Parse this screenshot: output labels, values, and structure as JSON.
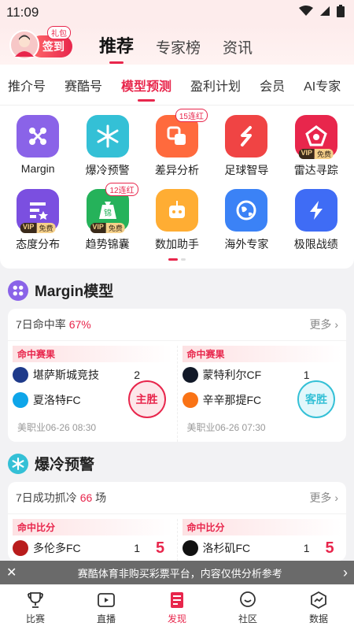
{
  "status_bar": {
    "time": "11:09"
  },
  "header": {
    "signin_label": "签到",
    "gift_tag": "礼包",
    "tabs": [
      {
        "label": "推荐"
      },
      {
        "label": "专家榜"
      },
      {
        "label": "资讯"
      }
    ]
  },
  "sub_tabs": [
    {
      "label": "推介号"
    },
    {
      "label": "赛酷号"
    },
    {
      "label": "模型预测"
    },
    {
      "label": "盈利计划"
    },
    {
      "label": "会员"
    },
    {
      "label": "AI专家"
    }
  ],
  "grid": {
    "row1": [
      {
        "label": "Margin",
        "icon": "margin-icon",
        "color": "#8a63e8"
      },
      {
        "label": "爆冷预警",
        "icon": "snowflake-icon",
        "color": "#34c0d6"
      },
      {
        "label": "差异分析",
        "icon": "difference-icon",
        "color": "#ff6a3d",
        "badge": "15连红"
      },
      {
        "label": "足球智导",
        "icon": "soccer-guide-icon",
        "color": "#f04444"
      },
      {
        "label": "雷达寻踪",
        "icon": "radar-icon",
        "color": "#e8264c",
        "vip": true
      }
    ],
    "row2": [
      {
        "label": "态度分布",
        "icon": "attitude-icon",
        "color": "#7b4fe0",
        "vip": true
      },
      {
        "label": "趋势锦囊",
        "icon": "trend-icon",
        "color": "#25b25a",
        "badge": "12连红",
        "vip": true
      },
      {
        "label": "数加助手",
        "icon": "robot-icon",
        "color": "#ffad33"
      },
      {
        "label": "海外专家",
        "icon": "globe-icon",
        "color": "#3b82f6"
      },
      {
        "label": "极限战绩",
        "icon": "lightning-icon",
        "color": "#3f6cf5"
      }
    ],
    "vip_text": "VIP",
    "free_text": "免费"
  },
  "margin_section": {
    "title": "Margin模型",
    "rate_label": "7日命中率",
    "rate_value": "67%",
    "more": "更多",
    "matches": [
      {
        "tag": "命中赛果",
        "home": "堪萨斯城竞技",
        "home_score": "2",
        "away": "夏洛特FC",
        "away_score": "1",
        "stamp": "主胜",
        "meta": "美职业06-26 08:30"
      },
      {
        "tag": "命中赛果",
        "home": "蒙特利尔CF",
        "home_score": "1",
        "away": "辛辛那提FC",
        "away_score": "3",
        "stamp": "客胜",
        "meta": "美职业06-26 07:30"
      }
    ]
  },
  "cold_section": {
    "title": "爆冷预警",
    "count_prefix": "7日成功抓冷",
    "count_value": "66",
    "count_suffix": "场",
    "more": "更多",
    "matches": [
      {
        "tag": "命中比分",
        "home": "多伦多FC",
        "home_score": "1",
        "big": "5"
      },
      {
        "tag": "命中比分",
        "home": "洛杉矶FC",
        "home_score": "1",
        "big": "5"
      }
    ]
  },
  "toast": {
    "text": "赛酷体育非购买彩票平台，内容仅供分析参考"
  },
  "bottom_nav": [
    {
      "label": "比赛"
    },
    {
      "label": "直播"
    },
    {
      "label": "发现"
    },
    {
      "label": "社区"
    },
    {
      "label": "数据"
    }
  ]
}
